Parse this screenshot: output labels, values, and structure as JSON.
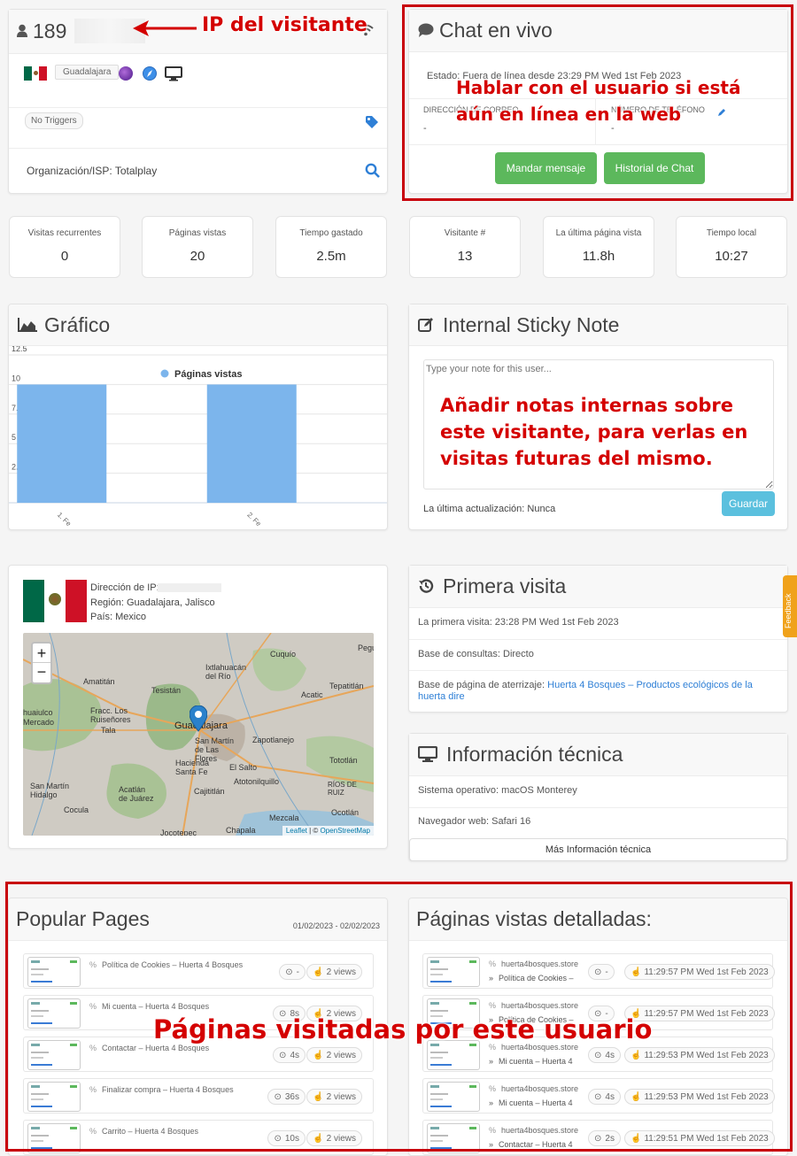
{
  "visitor": {
    "ip_prefix": "189",
    "city": "Guadalajara",
    "triggers": "No Triggers",
    "isp": "Organización/ISP: Totalplay"
  },
  "annotations": {
    "ip": "IP del visitante",
    "chat_line1": "Hablar con el usuario si está",
    "chat_line2": "aún en línea en la web",
    "notes": "Añadir notas internas sobre este visitante, para verlas en visitas futuras del mismo.",
    "pages": "Páginas visitadas por este usuario"
  },
  "chat": {
    "title": "Chat en vivo",
    "status": "Estado: Fuera de línea desde 23:29 PM Wed 1st Feb 2023",
    "email_label": "DIRECCIÓN DE CORREO",
    "phone_label": "NÚMERO DE TELÉFONO",
    "email_value": "-",
    "phone_value": "-",
    "send_button": "Mandar mensaje",
    "history_button": "Historial de Chat"
  },
  "stats": [
    {
      "label": "Visitas recurrentes",
      "value": "0"
    },
    {
      "label": "Páginas vistas",
      "value": "20"
    },
    {
      "label": "Tiempo gastado",
      "value": "2.5m"
    },
    {
      "label": "Visitante #",
      "value": "13"
    },
    {
      "label": "La última página vista",
      "value": "11.8h"
    },
    {
      "label": "Tiempo local",
      "value": "10:27"
    }
  ],
  "chart_panel": {
    "title": "Gráfico"
  },
  "chart_data": {
    "type": "bar",
    "categories": [
      "1. Fe",
      "2. Fe"
    ],
    "series": [
      {
        "name": "Páginas vistas",
        "values": [
          10,
          10
        ]
      }
    ],
    "ylim": [
      0,
      12.5
    ],
    "yticks": [
      "12.5",
      "10",
      "7.5",
      "5",
      "2.5"
    ],
    "legend": "top-center",
    "color": "#7cb5ec"
  },
  "note": {
    "title": "Internal Sticky Note",
    "placeholder": "Type your note for this user...",
    "updated": "La última actualización: Nunca",
    "save": "Guardar"
  },
  "location": {
    "ip_label": "Dirección de IP:",
    "region": "Región: Guadalajara, Jalisco",
    "country": "País: Mexico",
    "zoom_in": "+",
    "zoom_out": "−",
    "attribution_leaflet": "Leaflet",
    "attribution_sep": " | © ",
    "attribution_osm": "OpenStreetMap",
    "places": [
      "Cuquío",
      "Ixtlahuacán del Río",
      "Amatitán",
      "Tesistán",
      "Tepatitlán",
      "Acatic",
      "Fracc. Los Ruiseñores",
      "Tala",
      "huaiulco",
      "Mercado",
      "Guadalajara",
      "San Martín de Las Flores",
      "Zapotlanejo",
      "Hacienda Santa Fe",
      "El Salto",
      "Tototlán",
      "Atotonilquillo",
      "Acatlán de Juárez",
      "Cajititlán",
      "San Martín Hidalgo",
      "Cocula",
      "Ocotlán",
      "Mezcala",
      "Chapala",
      "Jocotepec",
      "RÍOS DE RUIZ",
      "Pegu"
    ]
  },
  "first_visit": {
    "title": "Primera visita",
    "date": "La primera visita: 23:28 PM Wed 1st Feb 2023",
    "referrer": "Base de consultas: Directo",
    "landing_label": "Base de página de aterrizaje: ",
    "landing_link": "Huerta 4 Bosques – Productos ecológicos de la huerta dire"
  },
  "tech": {
    "title": "Información técnica",
    "os": "Sistema operativo: macOS Monterey",
    "browser": "Navegador web: Safari 16",
    "more": "Más Información técnica"
  },
  "feedback_tab": "Feedback",
  "popular": {
    "title": "Popular Pages",
    "range": "01/02/2023 - 02/02/2023",
    "items": [
      {
        "title": "Política de Cookies – Huerta 4 Bosques",
        "time": "-",
        "views": "2 views"
      },
      {
        "title": "Mi cuenta – Huerta 4 Bosques",
        "time": "8s",
        "views": "2 views"
      },
      {
        "title": "Contactar – Huerta 4 Bosques",
        "time": "4s",
        "views": "2 views"
      },
      {
        "title": "Finalizar compra – Huerta 4 Bosques",
        "time": "36s",
        "views": "2 views"
      },
      {
        "title": "Carrito – Huerta 4 Bosques",
        "time": "10s",
        "views": "2 views"
      }
    ]
  },
  "detailed": {
    "title": "Páginas vistas detalladas:",
    "items": [
      {
        "site": "huerta4bosques.store",
        "page": "Política de Cookies –",
        "time": "-",
        "when": "11:29:57 PM Wed 1st Feb 2023"
      },
      {
        "site": "huerta4bosques.store",
        "page": "Política de Cookies –",
        "time": "-",
        "when": "11:29:57 PM Wed 1st Feb 2023"
      },
      {
        "site": "huerta4bosques.store",
        "page": "Mi cuenta – Huerta 4",
        "time": "4s",
        "when": "11:29:53 PM Wed 1st Feb 2023"
      },
      {
        "site": "huerta4bosques.store",
        "page": "Mi cuenta – Huerta 4",
        "time": "4s",
        "when": "11:29:53 PM Wed 1st Feb 2023"
      },
      {
        "site": "huerta4bosques.store",
        "page": "Contactar – Huerta 4",
        "time": "2s",
        "when": "11:29:51 PM Wed 1st Feb 2023"
      }
    ]
  }
}
